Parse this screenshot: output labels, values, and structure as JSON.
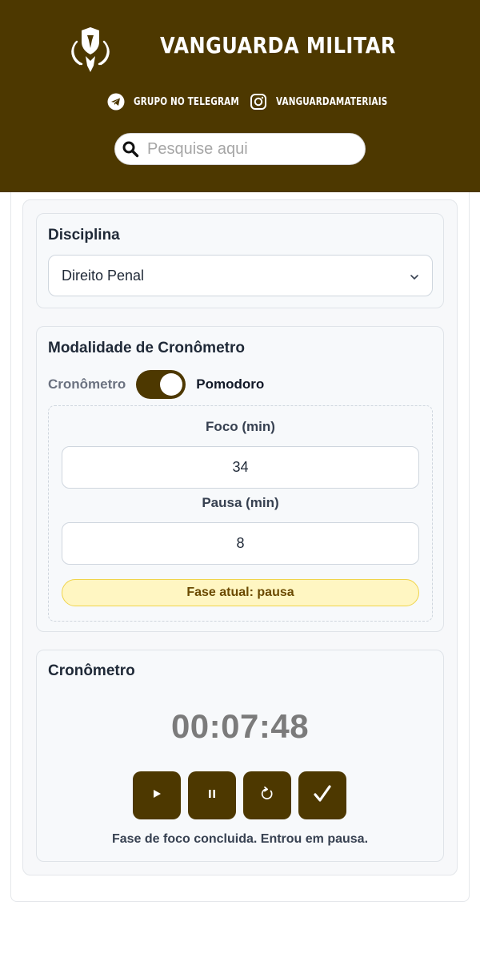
{
  "header": {
    "brand": "VANGUARDA MILITAR",
    "telegram_label": "GRUPO NO TELEGRAM",
    "instagram_label": "VANGUARDAMATERIAIS",
    "search_placeholder": "Pesquise aqui"
  },
  "disciplina": {
    "title": "Disciplina",
    "selected": "Direito Penal"
  },
  "modalidade": {
    "title": "Modalidade de Cronômetro",
    "left_label": "Cronômetro",
    "right_label": "Pomodoro",
    "pomodoro_on": true,
    "foco_label": "Foco (min)",
    "foco_value": "34",
    "pausa_label": "Pausa (min)",
    "pausa_value": "8",
    "fase": "Fase atual: pausa"
  },
  "cronometro": {
    "title": "Cronômetro",
    "time": "00:07:48",
    "message": "Fase de foco concluida. Entrou em pausa."
  },
  "colors": {
    "brand_brown": "#4d3800",
    "badge_yellow": "#fff6c2"
  },
  "icons": [
    "shield-eagle-logo",
    "telegram-icon",
    "instagram-icon",
    "search-icon",
    "chevron-down-icon",
    "play-icon",
    "pause-icon",
    "reset-icon",
    "check-icon"
  ]
}
